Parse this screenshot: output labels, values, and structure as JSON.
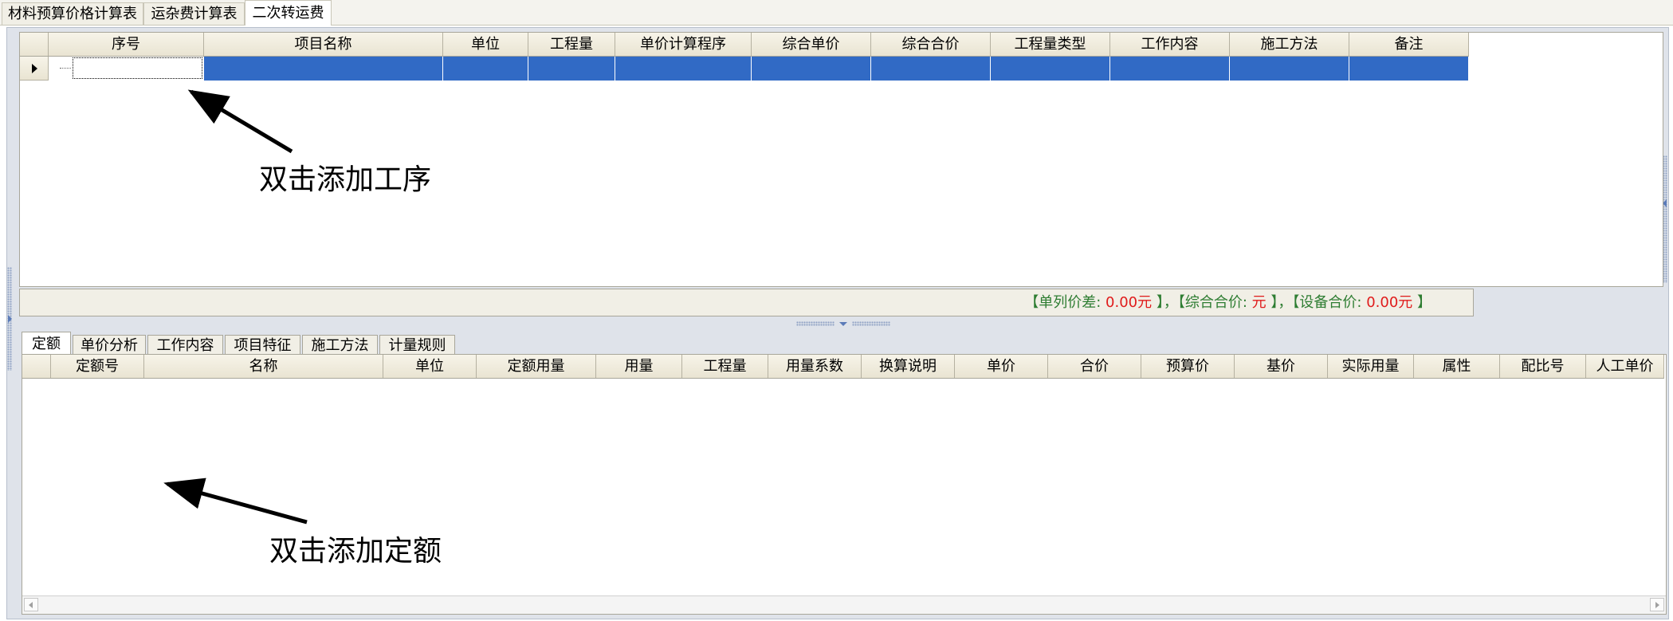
{
  "top_tabs": [
    {
      "label": "材料预算价格计算表",
      "active": false
    },
    {
      "label": "运杂费计算表",
      "active": false
    },
    {
      "label": "二次转运费",
      "active": true
    }
  ],
  "upper_grid": {
    "columns": [
      "序号",
      "项目名称",
      "单位",
      "工程量",
      "单价计算程序",
      "综合单价",
      "综合合价",
      "工程量类型",
      "工作内容",
      "施工方法",
      "备注"
    ]
  },
  "summary": {
    "open": "【",
    "close": "】",
    "sep": "，",
    "item1_label": "单列价差:",
    "item1_value": "0.00元",
    "item2_label": "综合合价:",
    "item2_value": "元",
    "item3_label": "设备合价:",
    "item3_value": "0.00元"
  },
  "lower_tabs": [
    {
      "label": "定额",
      "active": true
    },
    {
      "label": "单价分析",
      "active": false
    },
    {
      "label": "工作内容",
      "active": false
    },
    {
      "label": "项目特征",
      "active": false
    },
    {
      "label": "施工方法",
      "active": false
    },
    {
      "label": "计量规则",
      "active": false
    }
  ],
  "lower_grid": {
    "columns": [
      "定额号",
      "名称",
      "单位",
      "定额用量",
      "用量",
      "工程量",
      "用量系数",
      "换算说明",
      "单价",
      "合价",
      "预算价",
      "基价",
      "实际用量",
      "属性",
      "配比号",
      "人工单价"
    ]
  },
  "annotations": {
    "add_process": "双击添加工序",
    "add_quota": "双击添加定额"
  },
  "colors": {
    "selection": "#316ac5",
    "summary_label": "#2e7d32",
    "summary_value": "#e01b1b"
  }
}
